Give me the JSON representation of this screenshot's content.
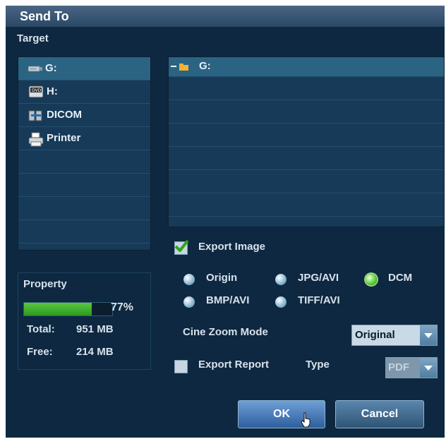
{
  "dialog": {
    "title": "Send To"
  },
  "target": {
    "heading": "Target",
    "items": [
      {
        "label": "G:",
        "icon": "usb-drive-icon",
        "selected": true
      },
      {
        "label": "H:",
        "icon": "dvd-drive-icon",
        "selected": false
      },
      {
        "label": "DICOM",
        "icon": "dicom-network-icon",
        "selected": false
      },
      {
        "label": "Printer",
        "icon": "printer-icon",
        "selected": false
      }
    ]
  },
  "folder_tree": {
    "root_label": "G:",
    "root_icon": "folder-icon",
    "expanded": true
  },
  "property": {
    "heading": "Property",
    "usage_percent_text": "77%",
    "usage_fraction": 0.77,
    "total_label": "Total:",
    "total_value": "951 MB",
    "free_label": "Free:",
    "free_value": "214 MB"
  },
  "export_image": {
    "label": "Export Image",
    "checked": true,
    "formats": [
      {
        "label": "Origin",
        "selected": false
      },
      {
        "label": "JPG/AVI",
        "selected": false
      },
      {
        "label": "DCM",
        "selected": true
      },
      {
        "label": "BMP/AVI",
        "selected": false
      },
      {
        "label": "TIFF/AVI",
        "selected": false
      }
    ],
    "cine_zoom_label": "Cine Zoom Mode",
    "cine_zoom_value": "Original"
  },
  "export_report": {
    "label": "Export Report",
    "checked": false,
    "type_label": "Type",
    "type_value": "PDF"
  },
  "buttons": {
    "ok": "OK",
    "cancel": "Cancel"
  },
  "colors": {
    "background": "#0d2840",
    "panel": "#163a58",
    "selection": "#2b6383",
    "progress": "#2e9a1f",
    "radio_selected": "#5fd33d"
  }
}
